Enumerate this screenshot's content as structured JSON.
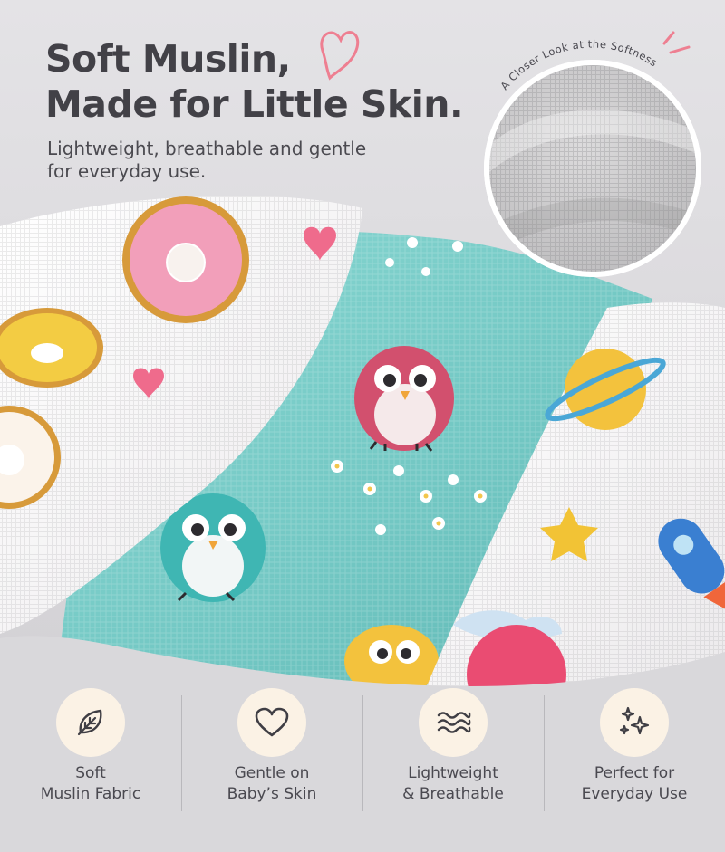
{
  "headline": {
    "line1": "Soft Muslin,",
    "line2": "Made for Little Skin."
  },
  "subtitle": {
    "line1": "Lightweight, breathable and gentle",
    "line2": "for everyday use."
  },
  "closeup": {
    "curved_label": "A Closer Look at the Softness"
  },
  "features": [
    {
      "icon": "leaf-icon",
      "line1": "Soft",
      "line2": "Muslin Fabric"
    },
    {
      "icon": "heart-icon",
      "line1": "Gentle on",
      "line2": "Baby’s Skin"
    },
    {
      "icon": "waves-icon",
      "line1": "Lightweight",
      "line2": "& Breathable"
    },
    {
      "icon": "sparkle-icon",
      "line1": "Perfect for",
      "line2": "Everyday Use"
    }
  ],
  "colors": {
    "background": "#d9d8db",
    "heading": "#424147",
    "accent_pink": "#ee7f91",
    "teal_fabric": "#79cdc9",
    "icon_badge": "#fbf2e5"
  }
}
